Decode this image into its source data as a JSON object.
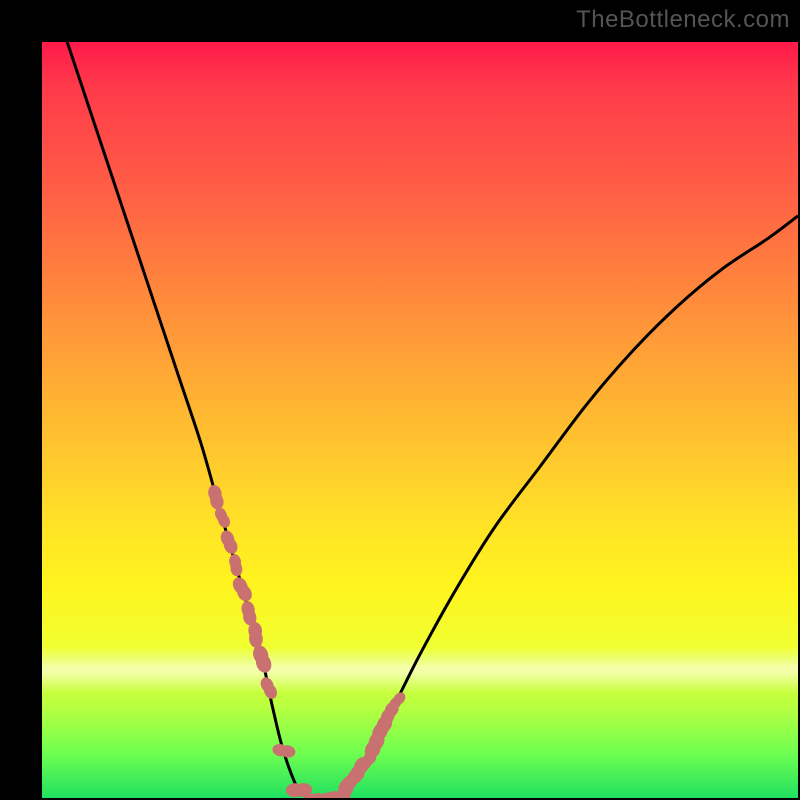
{
  "watermark": "TheBottleneck.com",
  "chart_data": {
    "type": "line",
    "title": "",
    "xlabel": "",
    "ylabel": "",
    "xlim": [
      0,
      100
    ],
    "ylim": [
      0,
      100
    ],
    "series": [
      {
        "name": "bottleneck-curve",
        "x": [
          3,
          6,
          9,
          12,
          15,
          18,
          21,
          23,
          25,
          27,
          29,
          30.5,
          32,
          34,
          36,
          38,
          40,
          43,
          46,
          50,
          55,
          60,
          66,
          72,
          78,
          84,
          90,
          96,
          100
        ],
        "values": [
          101,
          92,
          83,
          74,
          65,
          56,
          47,
          40,
          33,
          26,
          19,
          12,
          6,
          1,
          0,
          0,
          1,
          5,
          11,
          19,
          28,
          36,
          44,
          52,
          59,
          65,
          70,
          74,
          77
        ]
      }
    ],
    "markers": {
      "left_cluster": {
        "x_range": [
          23,
          30
        ],
        "y_range": [
          8,
          33
        ],
        "count": 9
      },
      "right_cluster": {
        "x_range": [
          40,
          47
        ],
        "y_range": [
          4,
          30
        ],
        "count": 8
      },
      "bottom_cluster": {
        "x_range": [
          32,
          38
        ],
        "y_range": [
          0,
          1
        ],
        "count": 4
      }
    },
    "marker_color": "#c97070",
    "curve_color": "#000000",
    "gradient_stops": [
      {
        "pct": 0,
        "color": "#ff1a4a"
      },
      {
        "pct": 50,
        "color": "#ffc62e"
      },
      {
        "pct": 75,
        "color": "#fff41e"
      },
      {
        "pct": 100,
        "color": "#20e060"
      }
    ]
  }
}
